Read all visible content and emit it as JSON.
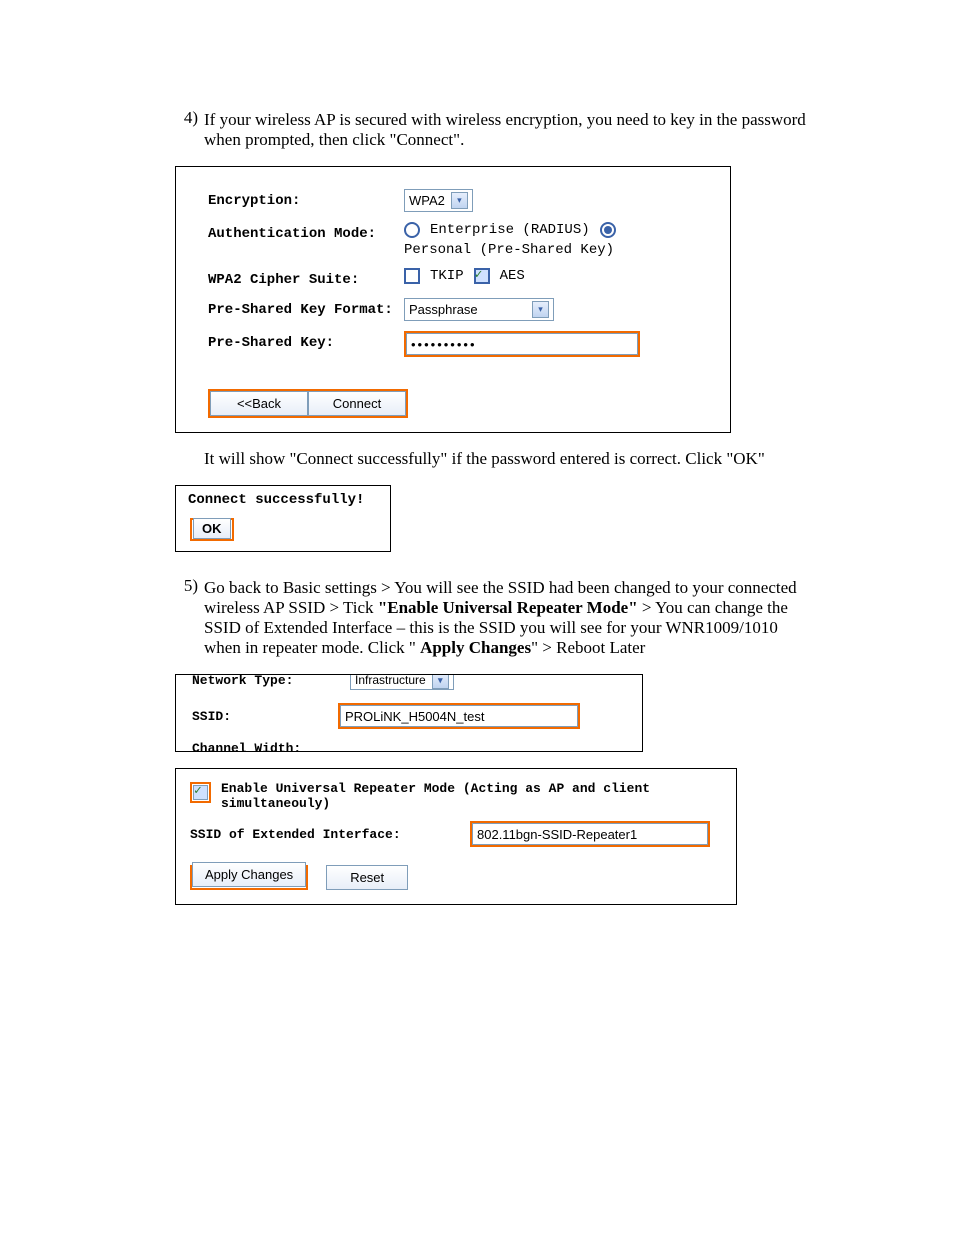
{
  "steps": {
    "s4": {
      "num": "4)",
      "text_a": "If your wireless AP is secured with wireless encryption, you need to key in the password when prompted, then click \"Connect\".",
      "text_b": "It will show \"Connect successfully\" if the password entered is correct. Click \"OK\""
    },
    "s5": {
      "num": "5)",
      "text_a": "Go back to Basic settings > You will see the SSID had been changed to your connected wireless AP SSID > Tick ",
      "bold1": "\"Enable Universal Repeater Mode\"",
      "text_b": " > You can change the SSID of  Extended Interface – this is the SSID you will see for your WNR1009/1010 when in repeater mode. Click \" ",
      "bold2": "Apply Changes",
      "text_c": "\" > Reboot Later"
    }
  },
  "enc": {
    "encryption_label": "Encryption:",
    "encryption_value": "WPA2",
    "auth_label": "Authentication Mode:",
    "auth_opt1": "Enterprise (RADIUS)",
    "auth_opt2": "Personal (Pre-Shared Key)",
    "cipher_label": "WPA2 Cipher Suite:",
    "cipher_opt1": "TKIP",
    "cipher_opt2": "AES",
    "psk_format_label": "Pre-Shared Key Format:",
    "psk_format_value": "Passphrase",
    "psk_label": "Pre-Shared Key:",
    "psk_value": "••••••••••",
    "back_btn": "<<Back",
    "connect_btn": "Connect"
  },
  "ok": {
    "msg": "Connect successfully!",
    "btn": "OK"
  },
  "ssid": {
    "top_label": "Network Type:",
    "top_value": "Infrastructure",
    "label": "SSID:",
    "value": "PROLiNK_H5004N_test",
    "bot_label": "Channel Width:"
  },
  "rep": {
    "title": "Enable Universal Repeater Mode (Acting as AP and client simultaneouly)",
    "ext_label": "SSID of Extended Interface:",
    "ext_value": "802.11bgn-SSID-Repeater1",
    "apply_btn": "Apply Changes",
    "reset_btn": "Reset"
  }
}
